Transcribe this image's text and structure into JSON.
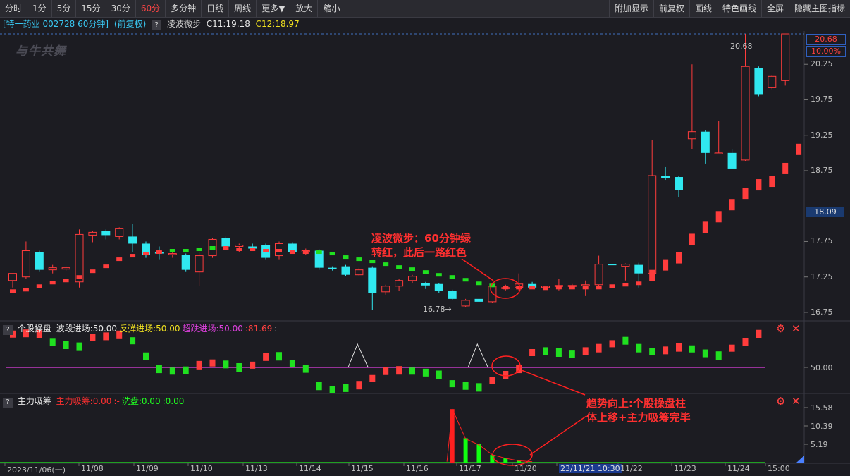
{
  "toolbar": {
    "left": [
      "分时",
      "1分",
      "5分",
      "15分",
      "30分",
      "60分",
      "多分钟",
      "日线",
      "周线",
      "更多▼",
      "放大",
      "缩小"
    ],
    "active": "60分",
    "right": [
      "附加显示",
      "前复权",
      "画线",
      "特色画线",
      "全屏",
      "隐藏主图指标"
    ]
  },
  "info": {
    "stock": "[特一药业 002728 60分钟]",
    "adjust": "(前复权)",
    "question": "?",
    "indicator": "凌波微步",
    "c1": "C11:19.18",
    "c2": "C12:18.97"
  },
  "logo": "与牛共舞",
  "main_axis": {
    "labels": [
      "20.25",
      "19.75",
      "19.25",
      "18.75",
      "17.75",
      "17.25",
      "16.75"
    ],
    "top_price": "20.68",
    "top_pct": "10.00%",
    "current": "18.09",
    "high_marker": "20.68",
    "low_marker": "16.78→"
  },
  "panel2": {
    "question": "?",
    "name": "个股操盘",
    "items": [
      {
        "text": "波段进场:50.00",
        "color": "#e8e8e8"
      },
      {
        "text": "反弹进场:50.00",
        "color": "#f0e020"
      },
      {
        "text": "超跌进场:50.00",
        "color": "#e040e0"
      },
      {
        "text": ":81.69",
        "color": "#ff4040"
      },
      {
        "text": ":-",
        "color": "#e8e8e8"
      }
    ],
    "axis": "50.00"
  },
  "panel3": {
    "question": "?",
    "name": "主力吸筹",
    "items": [
      {
        "text": "主力吸筹:0.00",
        "color": "#ff3030"
      },
      {
        "text": ":-",
        "color": "#ff3030"
      },
      {
        "text": "洗盘:0.00",
        "color": "#20ff20"
      },
      {
        "text": ":0.00",
        "color": "#20ff20"
      }
    ],
    "axis": [
      "15.58",
      "10.39",
      "5.19"
    ]
  },
  "xaxis": [
    "2023/11/06(一)",
    "11/08",
    "11/09",
    "11/10",
    "11/13",
    "11/14",
    "11/15",
    "11/16",
    "11/17",
    "11/20",
    "23/11/21 10:30",
    "11/22",
    "11/23",
    "11/24",
    "15:00"
  ],
  "annotations": {
    "a1": [
      "凌波微步：60分钟绿",
      "转红，此后一路红色"
    ],
    "a2": [
      "趋势向上:个股操盘柱",
      "体上移+主力吸筹完毕"
    ]
  },
  "colors": {
    "up": "#ff3c3c",
    "down": "#30e8f0",
    "green": "#20e020",
    "magenta": "#e040e0",
    "white": "#e0e0e0"
  },
  "chart_data": {
    "type": "candlestick",
    "price_range": [
      16.65,
      20.72
    ],
    "candles": [
      {
        "o": 17.2,
        "h": 17.3,
        "l": 17.1,
        "c": 17.3
      },
      {
        "o": 17.25,
        "h": 17.75,
        "l": 17.22,
        "c": 17.62
      },
      {
        "o": 17.6,
        "h": 17.62,
        "l": 17.32,
        "c": 17.35
      },
      {
        "o": 17.35,
        "h": 17.42,
        "l": 17.3,
        "c": 17.38
      },
      {
        "o": 17.36,
        "h": 17.4,
        "l": 17.33,
        "c": 17.38
      },
      {
        "o": 17.18,
        "h": 17.92,
        "l": 17.1,
        "c": 17.85
      },
      {
        "o": 17.84,
        "h": 17.9,
        "l": 17.74,
        "c": 17.88
      },
      {
        "o": 17.9,
        "h": 17.92,
        "l": 17.78,
        "c": 17.84
      },
      {
        "o": 17.82,
        "h": 17.95,
        "l": 17.78,
        "c": 17.93
      },
      {
        "o": 17.82,
        "h": 18.0,
        "l": 17.6,
        "c": 17.72
      },
      {
        "o": 17.72,
        "h": 17.75,
        "l": 17.52,
        "c": 17.56
      },
      {
        "o": 17.6,
        "h": 17.68,
        "l": 17.5,
        "c": 17.58
      },
      {
        "o": 17.58,
        "h": 17.62,
        "l": 17.52,
        "c": 17.58
      },
      {
        "o": 17.56,
        "h": 17.58,
        "l": 17.32,
        "c": 17.35
      },
      {
        "o": 17.32,
        "h": 17.6,
        "l": 17.12,
        "c": 17.55
      },
      {
        "o": 17.55,
        "h": 17.8,
        "l": 17.52,
        "c": 17.78
      },
      {
        "o": 17.8,
        "h": 17.82,
        "l": 17.65,
        "c": 17.68
      },
      {
        "o": 17.68,
        "h": 17.72,
        "l": 17.6,
        "c": 17.7
      },
      {
        "o": 17.68,
        "h": 17.72,
        "l": 17.62,
        "c": 17.65
      },
      {
        "o": 17.7,
        "h": 17.72,
        "l": 17.5,
        "c": 17.52
      },
      {
        "o": 17.55,
        "h": 17.75,
        "l": 17.5,
        "c": 17.72
      },
      {
        "o": 17.72,
        "h": 17.74,
        "l": 17.58,
        "c": 17.6
      },
      {
        "o": 17.6,
        "h": 17.65,
        "l": 17.56,
        "c": 17.62
      },
      {
        "o": 17.62,
        "h": 17.64,
        "l": 17.35,
        "c": 17.38
      },
      {
        "o": 17.38,
        "h": 17.4,
        "l": 17.34,
        "c": 17.36
      },
      {
        "o": 17.4,
        "h": 17.42,
        "l": 17.26,
        "c": 17.28
      },
      {
        "o": 17.28,
        "h": 17.38,
        "l": 17.26,
        "c": 17.35
      },
      {
        "o": 17.38,
        "h": 17.4,
        "l": 16.78,
        "c": 17.02
      },
      {
        "o": 17.04,
        "h": 17.14,
        "l": 17.0,
        "c": 17.12
      },
      {
        "o": 17.12,
        "h": 17.22,
        "l": 17.05,
        "c": 17.2
      },
      {
        "o": 17.2,
        "h": 17.28,
        "l": 17.16,
        "c": 17.26
      },
      {
        "o": 17.16,
        "h": 17.18,
        "l": 17.08,
        "c": 17.13
      },
      {
        "o": 17.15,
        "h": 17.16,
        "l": 17.02,
        "c": 17.05
      },
      {
        "o": 17.05,
        "h": 17.07,
        "l": 16.92,
        "c": 16.94
      },
      {
        "o": 16.84,
        "h": 16.94,
        "l": 16.82,
        "c": 16.92
      },
      {
        "o": 16.94,
        "h": 16.96,
        "l": 16.88,
        "c": 16.9
      },
      {
        "o": 16.9,
        "h": 17.15,
        "l": 16.88,
        "c": 17.12
      },
      {
        "o": 17.1,
        "h": 17.14,
        "l": 17.06,
        "c": 17.1
      },
      {
        "o": 17.1,
        "h": 17.3,
        "l": 17.06,
        "c": 17.15
      },
      {
        "o": 17.15,
        "h": 17.18,
        "l": 17.08,
        "c": 17.1
      },
      {
        "o": 17.1,
        "h": 17.12,
        "l": 17.08,
        "c": 17.12
      },
      {
        "o": 17.12,
        "h": 17.22,
        "l": 17.06,
        "c": 17.13
      },
      {
        "o": 17.12,
        "h": 17.15,
        "l": 17.08,
        "c": 17.13
      },
      {
        "o": 17.13,
        "h": 17.2,
        "l": 16.98,
        "c": 17.14
      },
      {
        "o": 17.14,
        "h": 17.55,
        "l": 17.1,
        "c": 17.43
      },
      {
        "o": 17.43,
        "h": 17.45,
        "l": 17.4,
        "c": 17.42
      },
      {
        "o": 17.4,
        "h": 17.44,
        "l": 17.2,
        "c": 17.43
      },
      {
        "o": 17.42,
        "h": 17.45,
        "l": 17.1,
        "c": 17.3
      },
      {
        "o": 17.3,
        "h": 19.18,
        "l": 17.28,
        "c": 18.68
      },
      {
        "o": 18.68,
        "h": 18.8,
        "l": 18.62,
        "c": 18.65
      },
      {
        "o": 18.66,
        "h": 18.68,
        "l": 18.38,
        "c": 18.48
      },
      {
        "o": 19.2,
        "h": 20.25,
        "l": 19.05,
        "c": 19.3
      },
      {
        "o": 19.3,
        "h": 19.32,
        "l": 18.85,
        "c": 19.0
      },
      {
        "o": 19.0,
        "h": 19.45,
        "l": 18.98,
        "c": 19.0
      },
      {
        "o": 19.0,
        "h": 19.05,
        "l": 18.78,
        "c": 18.78
      },
      {
        "o": 18.9,
        "h": 20.68,
        "l": 18.88,
        "c": 20.22
      },
      {
        "o": 20.2,
        "h": 20.22,
        "l": 19.8,
        "c": 19.82
      },
      {
        "o": 19.92,
        "h": 20.1,
        "l": 19.9,
        "c": 20.08
      },
      {
        "o": 20.02,
        "h": 20.68,
        "l": 19.95,
        "c": 20.68
      }
    ],
    "indicator_lbwb": [
      {
        "v": 17.05,
        "c": "r"
      },
      {
        "v": 17.07,
        "c": "r"
      },
      {
        "v": 17.12,
        "c": "r"
      },
      {
        "v": 17.17,
        "c": "r"
      },
      {
        "v": 17.2,
        "c": "r"
      },
      {
        "v": 17.25,
        "c": "r"
      },
      {
        "v": 17.33,
        "c": "r"
      },
      {
        "v": 17.4,
        "c": "r"
      },
      {
        "v": 17.5,
        "c": "r"
      },
      {
        "v": 17.55,
        "c": "r"
      },
      {
        "v": 17.58,
        "c": "r"
      },
      {
        "v": 17.6,
        "c": "r"
      },
      {
        "v": 17.62,
        "c": "g"
      },
      {
        "v": 17.62,
        "c": "g"
      },
      {
        "v": 17.64,
        "c": "g"
      },
      {
        "v": 17.66,
        "c": "g"
      },
      {
        "v": 17.66,
        "c": "r"
      },
      {
        "v": 17.64,
        "c": "r"
      },
      {
        "v": 17.64,
        "c": "r"
      },
      {
        "v": 17.62,
        "c": "r"
      },
      {
        "v": 17.62,
        "c": "r"
      },
      {
        "v": 17.6,
        "c": "r"
      },
      {
        "v": 17.6,
        "c": "r"
      },
      {
        "v": 17.6,
        "c": "g"
      },
      {
        "v": 17.58,
        "c": "g"
      },
      {
        "v": 17.53,
        "c": "g"
      },
      {
        "v": 17.5,
        "c": "g"
      },
      {
        "v": 17.47,
        "c": "g"
      },
      {
        "v": 17.43,
        "c": "g"
      },
      {
        "v": 17.39,
        "c": "g"
      },
      {
        "v": 17.36,
        "c": "g"
      },
      {
        "v": 17.32,
        "c": "g"
      },
      {
        "v": 17.28,
        "c": "g"
      },
      {
        "v": 17.25,
        "c": "g"
      },
      {
        "v": 17.21,
        "c": "g"
      },
      {
        "v": 17.16,
        "c": "g"
      },
      {
        "v": 17.13,
        "c": "g"
      },
      {
        "v": 17.1,
        "c": "r"
      },
      {
        "v": 17.1,
        "c": "r"
      },
      {
        "v": 17.1,
        "c": "r"
      },
      {
        "v": 17.09,
        "c": "r"
      },
      {
        "v": 17.1,
        "c": "r"
      },
      {
        "v": 17.1,
        "c": "r"
      },
      {
        "v": 17.1,
        "c": "r"
      },
      {
        "v": 17.1,
        "c": "r"
      },
      {
        "v": 17.12,
        "c": "r"
      },
      {
        "v": 17.14,
        "c": "r"
      },
      {
        "v": 17.16,
        "c": "r"
      },
      {
        "v": 17.27,
        "c": "r"
      },
      {
        "v": 17.42,
        "c": "r"
      },
      {
        "v": 17.52,
        "c": "r"
      },
      {
        "v": 17.78,
        "c": "r"
      },
      {
        "v": 17.95,
        "c": "r"
      },
      {
        "v": 18.1,
        "c": "r"
      },
      {
        "v": 18.27,
        "c": "r"
      },
      {
        "v": 18.43,
        "c": "r"
      },
      {
        "v": 18.55,
        "c": "r"
      },
      {
        "v": 18.6,
        "c": "r"
      },
      {
        "v": 18.78,
        "c": "r"
      },
      {
        "v": 19.05,
        "c": "r"
      }
    ],
    "panel2_range": [
      0,
      100
    ],
    "panel2_bars": [
      {
        "v": 95,
        "c": "r"
      },
      {
        "v": 96,
        "c": "r"
      },
      {
        "v": 95,
        "c": "r"
      },
      {
        "v": 84,
        "c": "g"
      },
      {
        "v": 80,
        "c": "g"
      },
      {
        "v": 78,
        "c": "g"
      },
      {
        "v": 90,
        "c": "r"
      },
      {
        "v": 92,
        "c": "r"
      },
      {
        "v": 94,
        "c": "r"
      },
      {
        "v": 86,
        "c": "g"
      },
      {
        "v": 65,
        "c": "g"
      },
      {
        "v": 48,
        "c": "g"
      },
      {
        "v": 45,
        "c": "g"
      },
      {
        "v": 46,
        "c": "g"
      },
      {
        "v": 53,
        "c": "r"
      },
      {
        "v": 56,
        "c": "r"
      },
      {
        "v": 54,
        "c": "g"
      },
      {
        "v": 50,
        "c": "g"
      },
      {
        "v": 53,
        "c": "r"
      },
      {
        "v": 64,
        "c": "r"
      },
      {
        "v": 65,
        "c": "g"
      },
      {
        "v": 55,
        "c": "g"
      },
      {
        "v": 48,
        "c": "g"
      },
      {
        "v": 25,
        "c": "g"
      },
      {
        "v": 20,
        "c": "g"
      },
      {
        "v": 22,
        "c": "g"
      },
      {
        "v": 26,
        "c": "r"
      },
      {
        "v": 35,
        "c": "r"
      },
      {
        "v": 45,
        "c": "r"
      },
      {
        "v": 46,
        "c": "r"
      },
      {
        "v": 45,
        "c": "g"
      },
      {
        "v": 43,
        "c": "g"
      },
      {
        "v": 40,
        "c": "g"
      },
      {
        "v": 28,
        "c": "g"
      },
      {
        "v": 25,
        "c": "g"
      },
      {
        "v": 23,
        "c": "g"
      },
      {
        "v": 32,
        "c": "r"
      },
      {
        "v": 40,
        "c": "r"
      },
      {
        "v": 48,
        "c": "r"
      },
      {
        "v": 70,
        "c": "r"
      },
      {
        "v": 72,
        "c": "g"
      },
      {
        "v": 70,
        "c": "g"
      },
      {
        "v": 68,
        "c": "g"
      },
      {
        "v": 72,
        "c": "r"
      },
      {
        "v": 76,
        "c": "r"
      },
      {
        "v": 82,
        "c": "r"
      },
      {
        "v": 86,
        "c": "g"
      },
      {
        "v": 76,
        "c": "g"
      },
      {
        "v": 71,
        "c": "g"
      },
      {
        "v": 73,
        "c": "r"
      },
      {
        "v": 77,
        "c": "r"
      },
      {
        "v": 75,
        "c": "g"
      },
      {
        "v": 69,
        "c": "g"
      },
      {
        "v": 66,
        "c": "g"
      },
      {
        "v": 76,
        "c": "r"
      },
      {
        "v": 84,
        "c": "r"
      },
      {
        "v": 95,
        "c": "r"
      }
    ],
    "panel2_triangles": [
      [
        25.5,
        26.2,
        27.0
      ],
      [
        34.5,
        35.2,
        36.0
      ]
    ],
    "panel3_range": [
      0,
      18
    ],
    "panel3_bars": [
      {
        "i": 33,
        "v": 17.5,
        "c": "r"
      },
      {
        "i": 34,
        "v": 8.0,
        "c": "g"
      },
      {
        "i": 35,
        "v": 6.0,
        "c": "g"
      },
      {
        "i": 36,
        "v": 2.5,
        "c": "g"
      },
      {
        "i": 37,
        "v": 1.5,
        "c": "g"
      },
      {
        "i": 38,
        "v": 0.8,
        "c": "g"
      }
    ],
    "panel3_line": [
      [
        32.6,
        0.3
      ],
      [
        33,
        17.5
      ],
      [
        34,
        7.8
      ],
      [
        35,
        5.8
      ],
      [
        36,
        2.6
      ],
      [
        37,
        1.4
      ],
      [
        38,
        0.6
      ],
      [
        39,
        0.3
      ]
    ]
  }
}
